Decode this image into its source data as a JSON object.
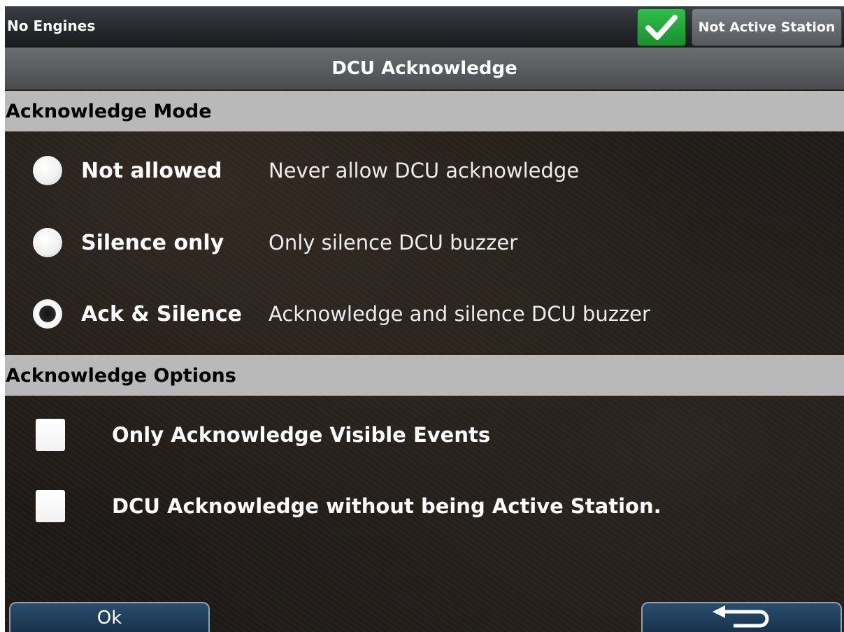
{
  "topbar": {
    "engine_status": "No Engines",
    "check_icon": "checkmark-icon",
    "check_color": "#2fbf4a",
    "station_label": "Not Active Station"
  },
  "title": "DCU Acknowledge",
  "acknowledge_mode": {
    "header": "Acknowledge Mode",
    "selected": "Ack & Silence",
    "options": [
      {
        "label": "Not allowed",
        "description": "Never allow DCU acknowledge",
        "selected": false
      },
      {
        "label": "Silence only",
        "description": "Only silence DCU buzzer",
        "selected": false
      },
      {
        "label": "Ack & Silence",
        "description": "Acknowledge and silence DCU buzzer",
        "selected": true
      }
    ]
  },
  "acknowledge_options": {
    "header": "Acknowledge Options",
    "items": [
      {
        "label": "Only Acknowledge Visible Events",
        "checked": false
      },
      {
        "label": "DCU Acknowledge without being Active Station.",
        "checked": false
      }
    ]
  },
  "footer": {
    "ok_label": "Ok",
    "back_icon": "back-arrow-icon"
  }
}
